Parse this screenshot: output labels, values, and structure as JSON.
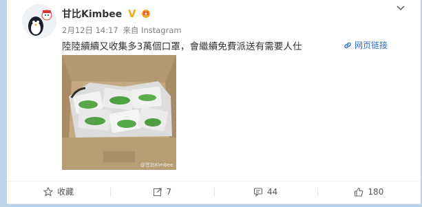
{
  "post": {
    "username": "甘比Kimbee",
    "date": "2月12日 14:17",
    "source": "来自 Instagram",
    "text": "陸陸續續又收集多3萬個口罩，會繼續免費派送有需要人仕",
    "web_link_label": "网页链接",
    "image_watermark": "@甘比Kimbee"
  },
  "actions": {
    "favorite_label": "收藏",
    "repost_count": "7",
    "comment_count": "44",
    "like_count": "180"
  },
  "colors": {
    "page_bg": "#bcd3ea",
    "link": "#2f6fc2",
    "verified_badge": "#f5a623"
  }
}
